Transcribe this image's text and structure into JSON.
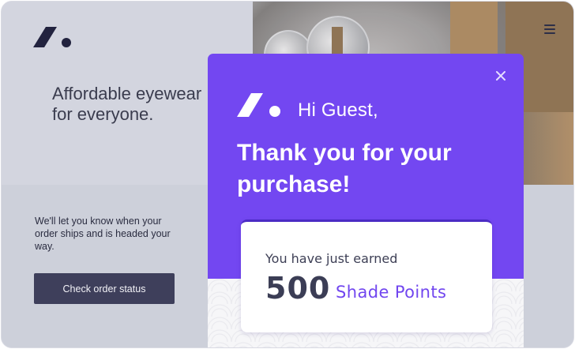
{
  "page": {
    "tagline_line1": "Affordable eyewear",
    "tagline_line2": "for everyone.",
    "ship_message": "We'll let you know when your order ships and is headed your way.",
    "check_order_button": "Check order status"
  },
  "modal": {
    "greeting": "Hi Guest,",
    "thanks": "Thank you for your purchase!",
    "earned_label": "You have just earned",
    "points_value": "500",
    "points_unit": "Shade Points"
  },
  "icons": {
    "brand": "brand-logo",
    "menu": "hamburger-menu-icon",
    "close": "close-icon"
  },
  "colors": {
    "accent": "#7347f1",
    "points_text": "#7146ef",
    "button_bg": "#3e3f5b",
    "background": "#d3d5df"
  }
}
